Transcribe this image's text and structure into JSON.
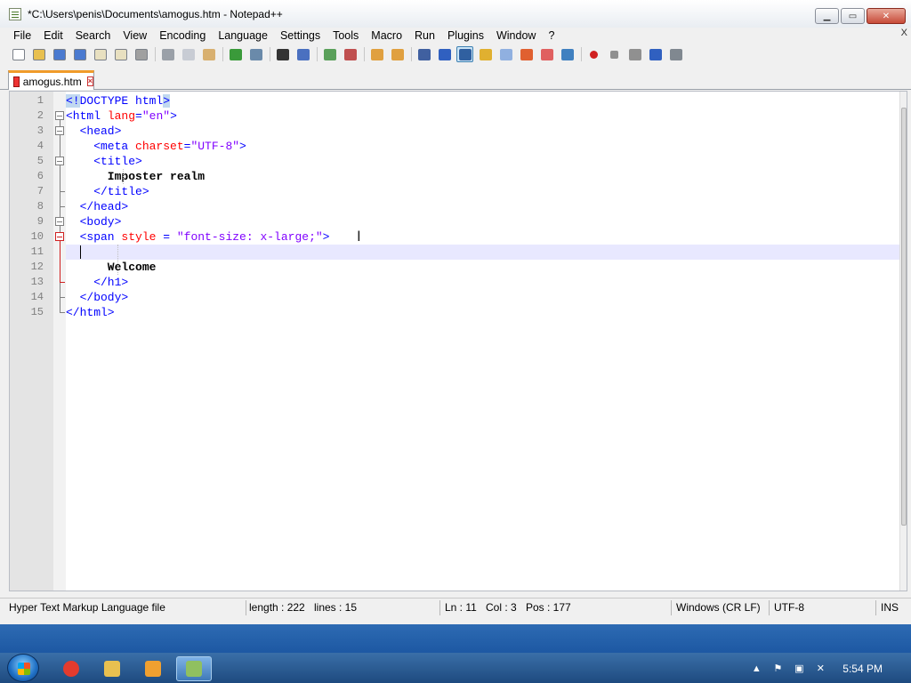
{
  "window": {
    "title": "*C:\\Users\\penis\\Documents\\amogus.htm - Notepad++"
  },
  "menu": {
    "items": [
      "File",
      "Edit",
      "Search",
      "View",
      "Encoding",
      "Language",
      "Settings",
      "Tools",
      "Macro",
      "Run",
      "Plugins",
      "Window",
      "?"
    ],
    "close_glyph": "X"
  },
  "toolbar": {
    "buttons": [
      {
        "name": "new-file",
        "color": "#ffffff"
      },
      {
        "name": "open-file",
        "color": "#e8c050"
      },
      {
        "name": "save",
        "color": "#4a7ad0"
      },
      {
        "name": "save-all",
        "color": "#4a7ad0"
      },
      {
        "name": "close",
        "color": "#e8e0c0"
      },
      {
        "name": "close-all",
        "color": "#e8e0c0"
      },
      {
        "name": "print",
        "color": "#a0a0a0"
      }
    ],
    "colors": {
      "accent": "#3c7fb1",
      "tab_accent": "#f09b2a"
    }
  },
  "tabs": [
    {
      "label": "amogus.htm",
      "close_glyph": "×",
      "active": true
    }
  ],
  "editor": {
    "lines": [
      {
        "num": "1",
        "tokens": [
          {
            "t": "<!DOCTYPE html>",
            "c": "tag"
          }
        ]
      },
      {
        "num": "2",
        "tokens": [
          {
            "t": "<html ",
            "c": "tag"
          },
          {
            "t": "lang",
            "c": "attr"
          },
          {
            "t": "=",
            "c": "tag"
          },
          {
            "t": "\"en\"",
            "c": "val"
          },
          {
            "t": ">",
            "c": "tag"
          }
        ]
      },
      {
        "num": "3",
        "tokens": [
          {
            "t": "  <head>",
            "c": "tag"
          }
        ]
      },
      {
        "num": "4",
        "tokens": [
          {
            "t": "    <meta ",
            "c": "tag"
          },
          {
            "t": "charset",
            "c": "attr"
          },
          {
            "t": "=",
            "c": "tag"
          },
          {
            "t": "\"UTF-8\"",
            "c": "val"
          },
          {
            "t": ">",
            "c": "tag"
          }
        ]
      },
      {
        "num": "5",
        "tokens": [
          {
            "t": "    <title>",
            "c": "tag"
          }
        ]
      },
      {
        "num": "6",
        "tokens": [
          {
            "t": "      Imposter realm",
            "c": "txt"
          }
        ]
      },
      {
        "num": "7",
        "tokens": [
          {
            "t": "    </title>",
            "c": "tag"
          }
        ]
      },
      {
        "num": "8",
        "tokens": [
          {
            "t": "  </head>",
            "c": "tag"
          }
        ]
      },
      {
        "num": "9",
        "tokens": [
          {
            "t": "  <body>",
            "c": "tag"
          }
        ]
      },
      {
        "num": "10",
        "tokens": [
          {
            "t": "  <span ",
            "c": "tag"
          },
          {
            "t": "style",
            "c": "attr"
          },
          {
            "t": " = ",
            "c": "tag"
          },
          {
            "t": "\"font-size: x-large;\"",
            "c": "val"
          },
          {
            "t": ">",
            "c": "tag"
          }
        ]
      },
      {
        "num": "11",
        "tokens": []
      },
      {
        "num": "12",
        "tokens": [
          {
            "t": "      Welcome",
            "c": "txt"
          }
        ]
      },
      {
        "num": "13",
        "tokens": [
          {
            "t": "    </h1>",
            "c": "tag"
          }
        ]
      },
      {
        "num": "14",
        "tokens": [
          {
            "t": "  </body>",
            "c": "tag"
          }
        ]
      },
      {
        "num": "15",
        "tokens": [
          {
            "t": "</html>",
            "c": "tag"
          }
        ]
      }
    ],
    "current_line": 11
  },
  "status": {
    "file_type": "Hyper Text Markup Language file",
    "length": "length : 222",
    "lines": "lines : 15",
    "ln": "Ln : 11",
    "col": "Col : 3",
    "pos": "Pos : 177",
    "eol": "Windows (CR LF)",
    "encoding": "UTF-8",
    "mode": "INS"
  },
  "taskbar": {
    "apps": [
      {
        "name": "chrome",
        "color": "#e33b2e"
      },
      {
        "name": "explorer",
        "color": "#e8c050"
      },
      {
        "name": "media-player",
        "color": "#f0a030"
      },
      {
        "name": "notepad-plus-plus",
        "color": "#90c060"
      }
    ],
    "clock": "5:54 PM"
  }
}
